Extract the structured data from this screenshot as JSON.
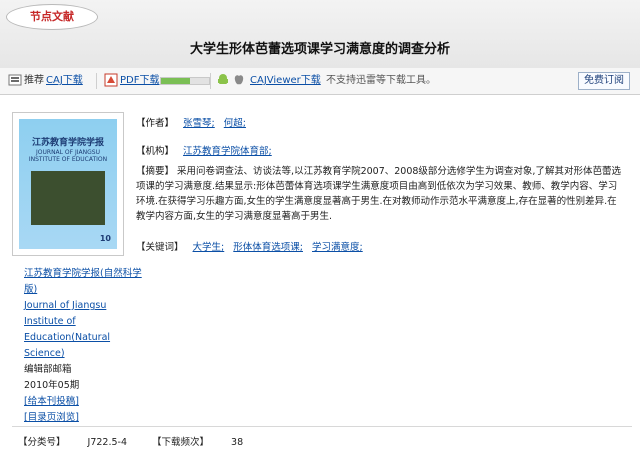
{
  "header": {
    "badge": "节点文献",
    "title": "大学生形体芭蕾选项课学习满意度的调查分析"
  },
  "toolbar": {
    "recommend_label": "推荐",
    "caj_download": "CAJ下载",
    "pdf_download": "PDF下载",
    "cajviewer_download": "CAJViewer下载",
    "notice": "不支持迅雷等下载工具。",
    "subscribe": "免费订阅",
    "pdf_progress": 0.6,
    "colors": {
      "accent": "#0b4fa6",
      "badge": "#c62828",
      "progress": "#7bbf55"
    },
    "icons": [
      "recommend-icon",
      "caj-icon",
      "pdf-icon",
      "android-icon",
      "apple-icon",
      "cajviewer-icon"
    ]
  },
  "cover": {
    "title": "江苏教育学院学报",
    "subtitle": "JOURNAL OF JIANGSU INSTITUTE OF EDUCATION",
    "issue": "10"
  },
  "journal": {
    "cn_name": "江苏教育学院学报(自然科学版)",
    "en_name": "Journal of Jiangsu Institute of Education(Natural Science)",
    "editor": "编辑部邮箱",
    "date": "2010年05期",
    "submit": "[给本刊投稿]",
    "toc": "[目录页浏览]"
  },
  "meta": {
    "author_label": "【作者】",
    "authors": [
      "张雪琴;",
      "何超;"
    ],
    "org_label": "【机构】",
    "org": "江苏教育学院体育部;",
    "abstract_label": "【摘要】",
    "abstract": "采用问卷调查法、访谈法等,以江苏教育学院2007、2008级部分选修学生为调查对象,了解其对形体芭蕾选项课的学习满意度.结果显示:形体芭蕾体育选项课学生满意度项目由高到低依次为学习效果、教师、教学内容、学习环境.在获得学习乐趣方面,女生的学生满意度显著高于男生.在对教师动作示范水平满意度上,存在显著的性别差异.在教学内容方面,女生的学习满意度显著高于男生.",
    "keywords_label": "【关键词】",
    "keywords": [
      "大学生;",
      "形体体育选项课;",
      "学习满意度;"
    ]
  },
  "footer": {
    "class_label": "【分类号】",
    "class_value": "J722.5-4",
    "downloads_label": "【下载频次】",
    "downloads_value": "38"
  }
}
